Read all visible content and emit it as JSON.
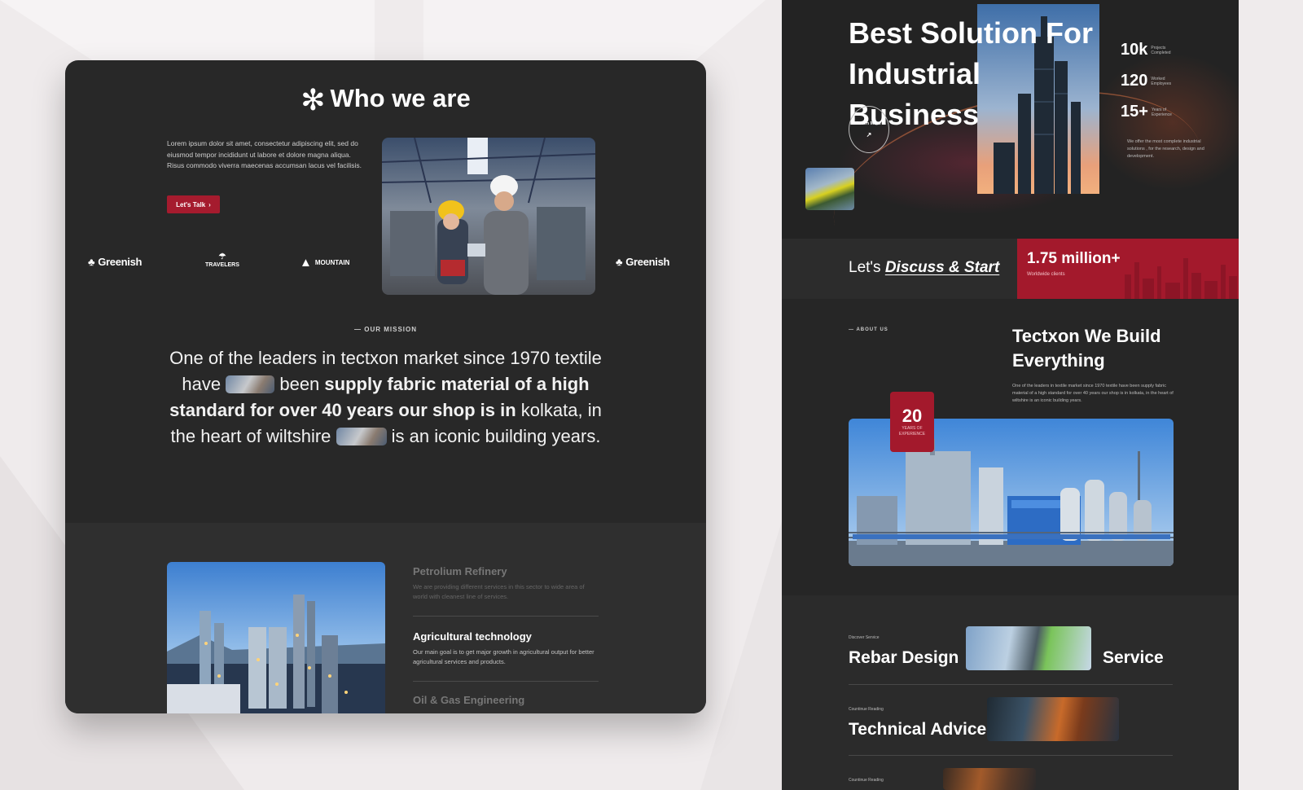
{
  "left_card": {
    "title": "Who we are",
    "intro": "Lorem ipsum dolor sit amet, consectetur adipiscing elit, sed do eiusmod tempor incididunt ut labore et dolore magna aliqua. Risus commodo viverra maecenas accumsan lacus vel facilisis.",
    "talk_button": "Let's Talk",
    "logos": [
      "Greenish",
      "TRAVELERS",
      "MOUNTAIN",
      "Greenish"
    ],
    "mission_label": "OUR MISSION",
    "mission": {
      "p1": "One of the leaders in tectxon market since 1970 textile have",
      "p2": "been",
      "p3": "supply fabric material of a high standard for over 40 years our shop is in",
      "p4": "kolkata, in the heart of wiltshire",
      "p5": "is an iconic building years."
    },
    "services": [
      {
        "title": "Petrolium Refinery",
        "desc": "We are providing different services in this sector to wide area of world with cleanest line of services."
      },
      {
        "title": "Agricultural technology",
        "desc": "Our main goal is to get major growth in agricultural output for better agricultural services and products."
      },
      {
        "title": "Oil & Gas Engineering",
        "desc": ""
      }
    ]
  },
  "right_panel": {
    "hero_title": "Best Solution For Industrial Business",
    "learn_more": "Learn More",
    "stats": [
      {
        "num": "10k",
        "label": "Projects Completed"
      },
      {
        "num": "120",
        "label": "Worked Employees"
      },
      {
        "num": "15+",
        "label": "Years of Experience"
      }
    ],
    "stats_desc": "We offer the most complete industrial solutions , for the research, design and development.",
    "discuss": {
      "pre": "Let's",
      "em": "Discuss & Start"
    },
    "million": {
      "num": "1.75 million+",
      "label": "Worldwide clients"
    },
    "about_label": "ABOUT US",
    "about_title": "Tectxon We Build Everything",
    "about_text": "One of the leaders in textile market since 1970 textile have been supply fabric material of a high standard for over 40 years our shop is in kolkata, in the heart of wiltshire is an iconic building years.",
    "years": {
      "num": "20",
      "label": "YEARS OF EXPERIENCE"
    },
    "service_rows": [
      {
        "tag": "Discover Service",
        "title": "Rebar Design",
        "title2": "Service"
      },
      {
        "tag": "Countinue Reading",
        "title": "Technical Advice"
      },
      {
        "tag": "Countinue Reading",
        "title": ""
      }
    ]
  },
  "colors": {
    "accent": "#a51b2e",
    "dark": "#282828",
    "bg": "#efebec"
  }
}
